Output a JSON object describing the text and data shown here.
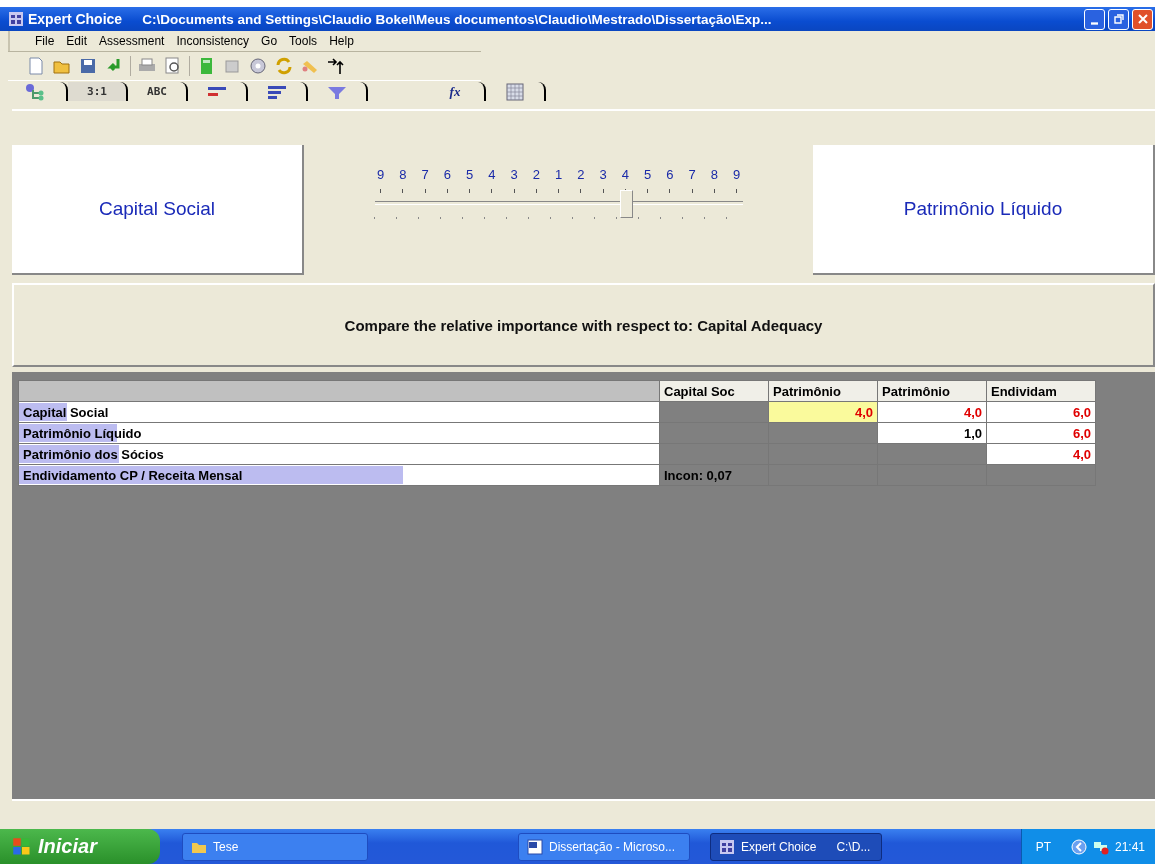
{
  "window": {
    "app": "Expert Choice",
    "title": "C:\\Documents and Settings\\Claudio Bokel\\Meus documentos\\Claudio\\Mestrado\\Dissertação\\Exp..."
  },
  "menu": [
    "File",
    "Edit",
    "Assessment",
    "Inconsistency",
    "Go",
    "Tools",
    "Help"
  ],
  "tabs": [
    {
      "kind": "icon",
      "selected": false
    },
    {
      "kind": "text",
      "label": "3:1",
      "selected": true
    },
    {
      "kind": "text",
      "label": "ABC",
      "selected": false
    },
    {
      "kind": "icon",
      "selected": false
    },
    {
      "kind": "icon",
      "selected": false
    },
    {
      "kind": "icon",
      "selected": false
    },
    {
      "kind": "formula",
      "label": "fx",
      "selected": false
    },
    {
      "kind": "icon",
      "selected": false
    }
  ],
  "comparison": {
    "left": "Capital Social",
    "right": "Patrimônio Líquido",
    "scale": [
      "9",
      "8",
      "7",
      "6",
      "5",
      "4",
      "3",
      "2",
      "1",
      "2",
      "3",
      "4",
      "5",
      "6",
      "7",
      "8",
      "9"
    ],
    "level": 0.68,
    "prompt": "Compare the relative importance with respect to: Capital Adequacy"
  },
  "matrix": {
    "columns": [
      "Capital Soc",
      "Patrimônio",
      "Patrimônio",
      "Endividam"
    ],
    "rows": [
      {
        "label": "Capital Social",
        "level": 0.075,
        "cells": [
          {
            "kind": "blank"
          },
          {
            "kind": "value",
            "text": "4,0",
            "selected": true,
            "inverted": true
          },
          {
            "kind": "value",
            "text": "4,0",
            "selected": false,
            "inverted": true
          },
          {
            "kind": "value",
            "text": "6,0",
            "selected": false,
            "inverted": true
          }
        ]
      },
      {
        "label": "Patrimônio Líquido",
        "level": 0.153,
        "cells": [
          {
            "kind": "blank"
          },
          {
            "kind": "blank"
          },
          {
            "kind": "value",
            "text": "1,0",
            "selected": false,
            "inverted": false
          },
          {
            "kind": "value",
            "text": "6,0",
            "selected": false,
            "inverted": true
          }
        ]
      },
      {
        "label": "Patrimônio dos Sócios",
        "level": 0.157,
        "cells": [
          {
            "kind": "blank"
          },
          {
            "kind": "blank"
          },
          {
            "kind": "blank"
          },
          {
            "kind": "value",
            "text": "4,0",
            "selected": false,
            "inverted": true
          }
        ]
      },
      {
        "label": "Endividamento CP / Receita Mensal",
        "level": 0.6,
        "cells": [
          {
            "kind": "note",
            "text": "Incon: 0,07"
          },
          {
            "kind": "blank"
          },
          {
            "kind": "blank"
          },
          {
            "kind": "blank"
          }
        ]
      }
    ]
  },
  "taskbar": {
    "start": "Iniciar",
    "items": [
      {
        "label": "Tese",
        "selected": false
      },
      {
        "label": "Dissertação - Microso...",
        "selected": false
      },
      {
        "label": "Expert Choice",
        "detail": "C:\\D...",
        "selected": true
      }
    ],
    "language": "PT",
    "clock": "21:41"
  }
}
